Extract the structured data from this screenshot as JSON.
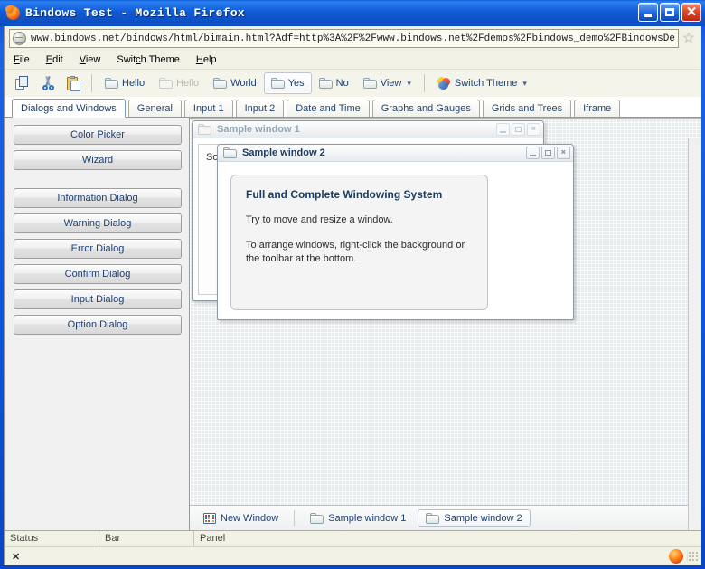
{
  "window": {
    "title": "Bindows Test - Mozilla Firefox",
    "minimize_label": "",
    "maximize_label": "",
    "close_label": "✕"
  },
  "browser": {
    "url": "www.bindows.net/bindows/html/bimain.html?Adf=http%3A%2F%2Fwww.bindows.net%2Fdemos%2Fbindows_demo%2FBindowsDemo.xml;Adf]",
    "globe_icon": "globe-icon",
    "star_icon": "star-icon",
    "menus": [
      {
        "label": "File",
        "accel": "F"
      },
      {
        "label": "Edit",
        "accel": "E"
      },
      {
        "label": "View",
        "accel": "V"
      },
      {
        "label": "Switch Theme",
        "accel": "c"
      },
      {
        "label": "Help",
        "accel": "H"
      }
    ]
  },
  "toolbar": {
    "icon_buttons": [
      {
        "name": "copy-icon",
        "label": "Copy"
      },
      {
        "name": "cut-icon",
        "label": "Cut"
      },
      {
        "name": "paste-icon",
        "label": "Paste"
      }
    ],
    "buttons": [
      {
        "label": "Hello",
        "icon": "folder-icon",
        "state": "normal",
        "caret": false
      },
      {
        "label": "Hello",
        "icon": "folder-icon",
        "state": "disabled",
        "caret": false
      },
      {
        "label": "World",
        "icon": "folder-icon",
        "state": "normal",
        "caret": false
      },
      {
        "label": "Yes",
        "icon": "folder-icon",
        "state": "pressed",
        "caret": false
      },
      {
        "label": "No",
        "icon": "folder-icon",
        "state": "normal",
        "caret": false
      },
      {
        "label": "View",
        "icon": "folder-icon",
        "state": "normal",
        "caret": true
      },
      {
        "label": "Switch Theme",
        "icon": "theme-icon",
        "state": "normal",
        "caret": true
      }
    ]
  },
  "tabs": [
    {
      "label": "Dialogs and Windows",
      "active": true
    },
    {
      "label": "General",
      "active": false
    },
    {
      "label": "Input 1",
      "active": false
    },
    {
      "label": "Input 2",
      "active": false
    },
    {
      "label": "Date and Time",
      "active": false
    },
    {
      "label": "Graphs and Gauges",
      "active": false
    },
    {
      "label": "Grids and Trees",
      "active": false
    },
    {
      "label": "Iframe",
      "active": false
    }
  ],
  "left_pane": {
    "group1": [
      {
        "label": "Color Picker"
      },
      {
        "label": "Wizard"
      }
    ],
    "group2": [
      {
        "label": "Information Dialog"
      },
      {
        "label": "Warning Dialog"
      },
      {
        "label": "Error Dialog"
      },
      {
        "label": "Confirm Dialog"
      },
      {
        "label": "Input Dialog"
      },
      {
        "label": "Option Dialog"
      }
    ]
  },
  "windows": [
    {
      "title": "Sample window 1",
      "active": false,
      "icon": "folder-icon",
      "body_text": "So",
      "controls": {
        "minimize": "minimize-icon",
        "maximize": "maximize-icon",
        "close": "close-icon"
      }
    },
    {
      "title": "Sample window 2",
      "active": true,
      "icon": "folder-icon",
      "card": {
        "heading": "Full and Complete Windowing System",
        "paragraph1": "Try to move and resize a window.",
        "paragraph2": "To arrange windows, right-click the background or the toolbar at the bottom."
      },
      "controls": {
        "minimize": "minimize-icon",
        "maximize": "maximize-icon",
        "close": "close-icon"
      }
    }
  ],
  "taskbar": {
    "new_window": {
      "label": "New Window",
      "icon": "grid-icon"
    },
    "tasks": [
      {
        "label": "Sample window 1",
        "icon": "folder-icon",
        "selected": false
      },
      {
        "label": "Sample window 2",
        "icon": "folder-icon",
        "selected": true
      }
    ]
  },
  "statusbar": {
    "cell1": "Status",
    "cell2": "Bar",
    "cell3": "Panel"
  },
  "firefox_status": {
    "close_label": "✕",
    "firefox_icon": "firefox-icon",
    "resize_grip": "resize-grip-icon"
  },
  "colors": {
    "titlebar_blue": "#0b55e0",
    "accent_text": "#1d3f73",
    "chrome_bg": "#f2f1e6",
    "desktop_bg": "#e6ecee",
    "close_red": "#e2472a"
  }
}
